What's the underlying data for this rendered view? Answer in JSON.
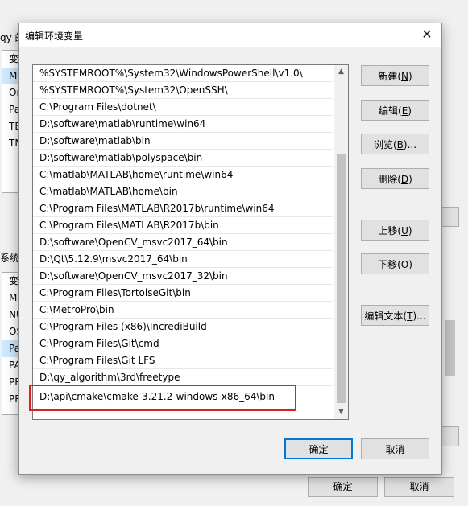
{
  "background": {
    "title_fragment": "qy 的",
    "user_vars_col_header": "变",
    "user_var_rows": [
      "M",
      "Or",
      "Pa",
      "TE",
      "TM"
    ],
    "system_section_label": "系统",
    "system_vars_col_header": "变",
    "system_var_rows": [
      "M",
      "NU",
      "OS",
      "Pa",
      "PA",
      "PR",
      "PR"
    ],
    "ok_label": "确定",
    "cancel_label": "取消"
  },
  "dialog": {
    "title": "编辑环境变量",
    "close_glyph": "✕",
    "paths": [
      "%SYSTEMROOT%\\System32\\WindowsPowerShell\\v1.0\\",
      "%SYSTEMROOT%\\System32\\OpenSSH\\",
      "C:\\Program Files\\dotnet\\",
      "D:\\software\\matlab\\runtime\\win64",
      "D:\\software\\matlab\\bin",
      "D:\\software\\matlab\\polyspace\\bin",
      "C:\\matlab\\MATLAB\\home\\runtime\\win64",
      "C:\\matlab\\MATLAB\\home\\bin",
      "C:\\Program Files\\MATLAB\\R2017b\\runtime\\win64",
      "C:\\Program Files\\MATLAB\\R2017b\\bin",
      "D:\\software\\OpenCV_msvc2017_64\\bin",
      "D:\\Qt\\5.12.9\\msvc2017_64\\bin",
      "D:\\software\\OpenCV_msvc2017_32\\bin",
      "C:\\Program Files\\TortoiseGit\\bin",
      "C:\\MetroPro\\bin",
      "C:\\Program Files (x86)\\IncrediBuild",
      "C:\\Program Files\\Git\\cmd",
      "C:\\Program Files\\Git LFS",
      "D:\\qy_algorithm\\3rd\\freetype",
      "D:\\api\\cmake\\cmake-3.21.2-windows-x86_64\\bin"
    ],
    "buttons": {
      "new": {
        "text": "新建(",
        "key": "N",
        "end": ")"
      },
      "edit": {
        "text": "编辑(",
        "key": "E",
        "end": ")"
      },
      "browse": {
        "text": "浏览(",
        "key": "B",
        "end": ")..."
      },
      "delete": {
        "text": "删除(",
        "key": "D",
        "end": ")"
      },
      "move_up": {
        "text": "上移(",
        "key": "U",
        "end": ")"
      },
      "move_down": {
        "text": "下移(",
        "key": "O",
        "end": ")"
      },
      "edit_text": {
        "text": "编辑文本(",
        "key": "T",
        "end": ")..."
      }
    },
    "ok_label": "确定",
    "cancel_label": "取消"
  },
  "colors": {
    "highlight_border": "#e02020",
    "primary_button_border": "#0078d7"
  }
}
